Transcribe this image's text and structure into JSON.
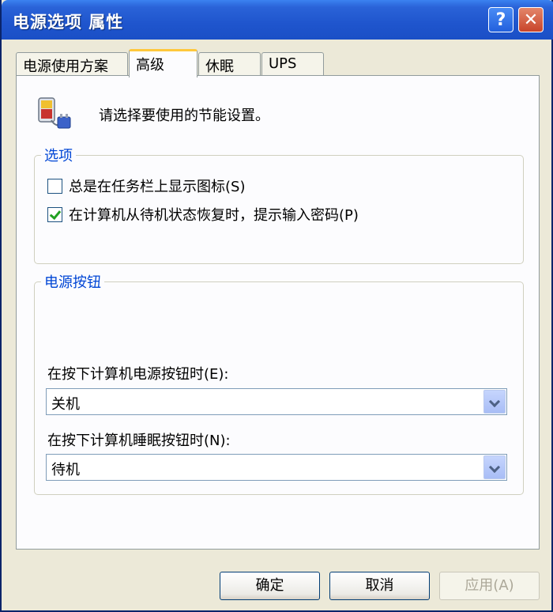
{
  "window": {
    "title": "电源选项 属性"
  },
  "titlebar": {
    "help_glyph": "?",
    "close_glyph": "✕"
  },
  "tabs": [
    {
      "label": "电源使用方案",
      "active": false
    },
    {
      "label": "高级",
      "active": true
    },
    {
      "label": "休眠",
      "active": false
    },
    {
      "label": "UPS",
      "active": false
    }
  ],
  "panel": {
    "icon": "power-options-icon",
    "header_text": "请选择要使用的节能设置。"
  },
  "options_group": {
    "label": "选项",
    "checkboxes": [
      {
        "label": "总是在任务栏上显示图标(S)",
        "checked": false
      },
      {
        "label": "在计算机从待机状态恢复时，提示输入密码(P)",
        "checked": true
      }
    ]
  },
  "power_buttons_group": {
    "label": "电源按钮",
    "power_button": {
      "label": "在按下计算机电源按钮时(E):",
      "value": "关机"
    },
    "sleep_button": {
      "label": "在按下计算机睡眠按钮时(N):",
      "value": "待机"
    }
  },
  "buttons": {
    "ok": "确定",
    "cancel": "取消",
    "apply": "应用(A)"
  }
}
